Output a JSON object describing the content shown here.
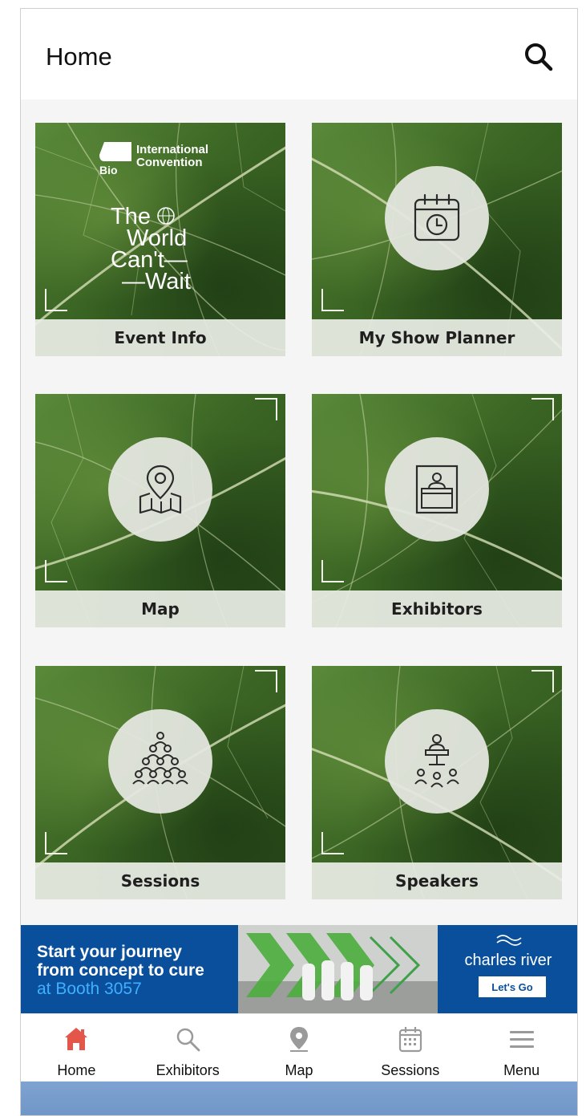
{
  "header": {
    "title": "Home"
  },
  "tiles": [
    {
      "label": "Event Info",
      "icon": "event-logo"
    },
    {
      "label": "My Show Planner",
      "icon": "calendar-clock-icon"
    },
    {
      "label": "Map",
      "icon": "map-pin-icon"
    },
    {
      "label": "Exhibitors",
      "icon": "exhibitor-booth-icon"
    },
    {
      "label": "Sessions",
      "icon": "people-pyramid-icon"
    },
    {
      "label": "Speakers",
      "icon": "speaker-podium-icon"
    }
  ],
  "event_logo": {
    "org_line1": "International",
    "org_line2": "Convention",
    "bio": "Bio",
    "tagline_1": "The",
    "tagline_2": "World",
    "tagline_3": "Can't—",
    "tagline_4": "—Wait"
  },
  "ad": {
    "line1": "Start your journey",
    "line2": "from concept to cure",
    "line3": "at Booth 3057",
    "brand": "charles river",
    "cta": "Let's Go"
  },
  "bottom_nav": [
    {
      "label": "Home",
      "icon": "home-icon",
      "active": true
    },
    {
      "label": "Exhibitors",
      "icon": "search-icon",
      "active": false
    },
    {
      "label": "Map",
      "icon": "map-pin-icon",
      "active": false
    },
    {
      "label": "Sessions",
      "icon": "calendar-icon",
      "active": false
    },
    {
      "label": "Menu",
      "icon": "hamburger-menu-icon",
      "active": false
    }
  ],
  "colors": {
    "active_nav": "#e4564a",
    "inactive_nav": "#9a9a9a",
    "ad_background": "#0a4f9c",
    "ad_highlight": "#3fb0ff"
  }
}
